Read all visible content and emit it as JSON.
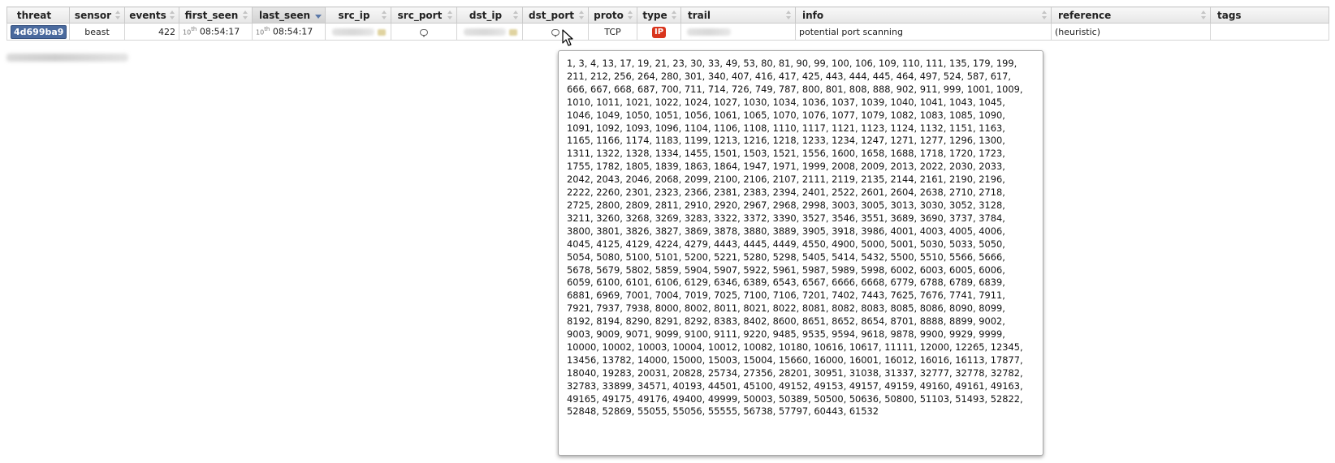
{
  "columns": [
    {
      "key": "threat",
      "label": "threat"
    },
    {
      "key": "sensor",
      "label": "sensor"
    },
    {
      "key": "events",
      "label": "events"
    },
    {
      "key": "first_seen",
      "label": "first_seen"
    },
    {
      "key": "last_seen",
      "label": "last_seen"
    },
    {
      "key": "src_ip",
      "label": "src_ip"
    },
    {
      "key": "src_port",
      "label": "src_port"
    },
    {
      "key": "dst_ip",
      "label": "dst_ip"
    },
    {
      "key": "dst_port",
      "label": "dst_port"
    },
    {
      "key": "proto",
      "label": "proto"
    },
    {
      "key": "type",
      "label": "type"
    },
    {
      "key": "trail",
      "label": "trail"
    },
    {
      "key": "info",
      "label": "info"
    },
    {
      "key": "reference",
      "label": "reference"
    },
    {
      "key": "tags",
      "label": "tags"
    }
  ],
  "row": {
    "threat": "4d699ba9",
    "sensor": "beast",
    "events": "422",
    "first_seen_day": "10",
    "first_seen_suffix": "th",
    "first_seen_time": "08:54:17",
    "last_seen_day": "10",
    "last_seen_suffix": "th",
    "last_seen_time": "08:54:17",
    "proto": "TCP",
    "type": "IP",
    "info": "potential port scanning",
    "reference": "(heuristic)",
    "tags": ""
  },
  "sort": {
    "column": "last_seen",
    "direction": "desc"
  },
  "icons": {
    "src_port": "comment-bubble-icon",
    "dst_port": "comment-bubble-icon",
    "cursor": "mouse-pointer-icon"
  },
  "colors": {
    "threat_badge": "#4a6a9e",
    "type_badge": "#d9351d"
  },
  "tooltip": {
    "ports": "1, 3, 4, 13, 17, 19, 21, 23, 30, 33, 49, 53, 80, 81, 90, 99, 100, 106, 109, 110, 111, 135, 179, 199, 211, 212, 256, 264, 280, 301, 340, 407, 416, 417, 425, 443, 444, 445, 464, 497, 524, 587, 617, 666, 667, 668, 687, 700, 711, 714, 726, 749, 787, 800, 801, 808, 888, 902, 911, 999, 1001, 1009, 1010, 1011, 1021, 1022, 1024, 1027, 1030, 1034, 1036, 1037, 1039, 1040, 1041, 1043, 1045, 1046, 1049, 1050, 1051, 1056, 1061, 1065, 1070, 1076, 1077, 1079, 1082, 1083, 1085, 1090, 1091, 1092, 1093, 1096, 1104, 1106, 1108, 1110, 1117, 1121, 1123, 1124, 1132, 1151, 1163, 1165, 1166, 1174, 1183, 1199, 1213, 1216, 1218, 1233, 1234, 1247, 1271, 1277, 1296, 1300, 1311, 1322, 1328, 1334, 1455, 1501, 1503, 1521, 1556, 1600, 1658, 1688, 1718, 1720, 1723, 1755, 1782, 1805, 1839, 1863, 1864, 1947, 1971, 1999, 2008, 2009, 2013, 2022, 2030, 2033, 2042, 2043, 2046, 2068, 2099, 2100, 2106, 2107, 2111, 2119, 2135, 2144, 2161, 2190, 2196, 2222, 2260, 2301, 2323, 2366, 2381, 2383, 2394, 2401, 2522, 2601, 2604, 2638, 2710, 2718, 2725, 2800, 2809, 2811, 2910, 2920, 2967, 2968, 2998, 3003, 3005, 3013, 3030, 3052, 3128, 3211, 3260, 3268, 3269, 3283, 3322, 3372, 3390, 3527, 3546, 3551, 3689, 3690, 3737, 3784, 3800, 3801, 3826, 3827, 3869, 3878, 3880, 3889, 3905, 3918, 3986, 4001, 4003, 4005, 4006, 4045, 4125, 4129, 4224, 4279, 4443, 4445, 4449, 4550, 4900, 5000, 5001, 5030, 5033, 5050, 5054, 5080, 5100, 5101, 5200, 5221, 5280, 5298, 5405, 5414, 5432, 5500, 5510, 5566, 5666, 5678, 5679, 5802, 5859, 5904, 5907, 5922, 5961, 5987, 5989, 5998, 6002, 6003, 6005, 6006, 6059, 6100, 6101, 6106, 6129, 6346, 6389, 6543, 6567, 6666, 6668, 6779, 6788, 6789, 6839, 6881, 6969, 7001, 7004, 7019, 7025, 7100, 7106, 7201, 7402, 7443, 7625, 7676, 7741, 7911, 7921, 7937, 7938, 8000, 8002, 8011, 8021, 8022, 8081, 8082, 8083, 8085, 8086, 8090, 8099, 8192, 8194, 8290, 8291, 8292, 8383, 8402, 8600, 8651, 8652, 8654, 8701, 8888, 8899, 9002, 9003, 9009, 9071, 9099, 9100, 9111, 9220, 9485, 9535, 9594, 9618, 9878, 9900, 9929, 9999, 10000, 10002, 10003, 10004, 10012, 10082, 10180, 10616, 10617, 11111, 12000, 12265, 12345, 13456, 13782, 14000, 15000, 15003, 15004, 15660, 16000, 16001, 16012, 16016, 16113, 17877, 18040, 19283, 20031, 20828, 25734, 27356, 28201, 30951, 31038, 31337, 32777, 32778, 32782, 32783, 33899, 34571, 40193, 44501, 45100, 49152, 49153, 49157, 49159, 49160, 49161, 49163, 49165, 49175, 49176, 49400, 49999, 50003, 50389, 50500, 50636, 50800, 51103, 51493, 52822, 52848, 52869, 55055, 55056, 55555, 56738, 57797, 60443, 61532"
  }
}
